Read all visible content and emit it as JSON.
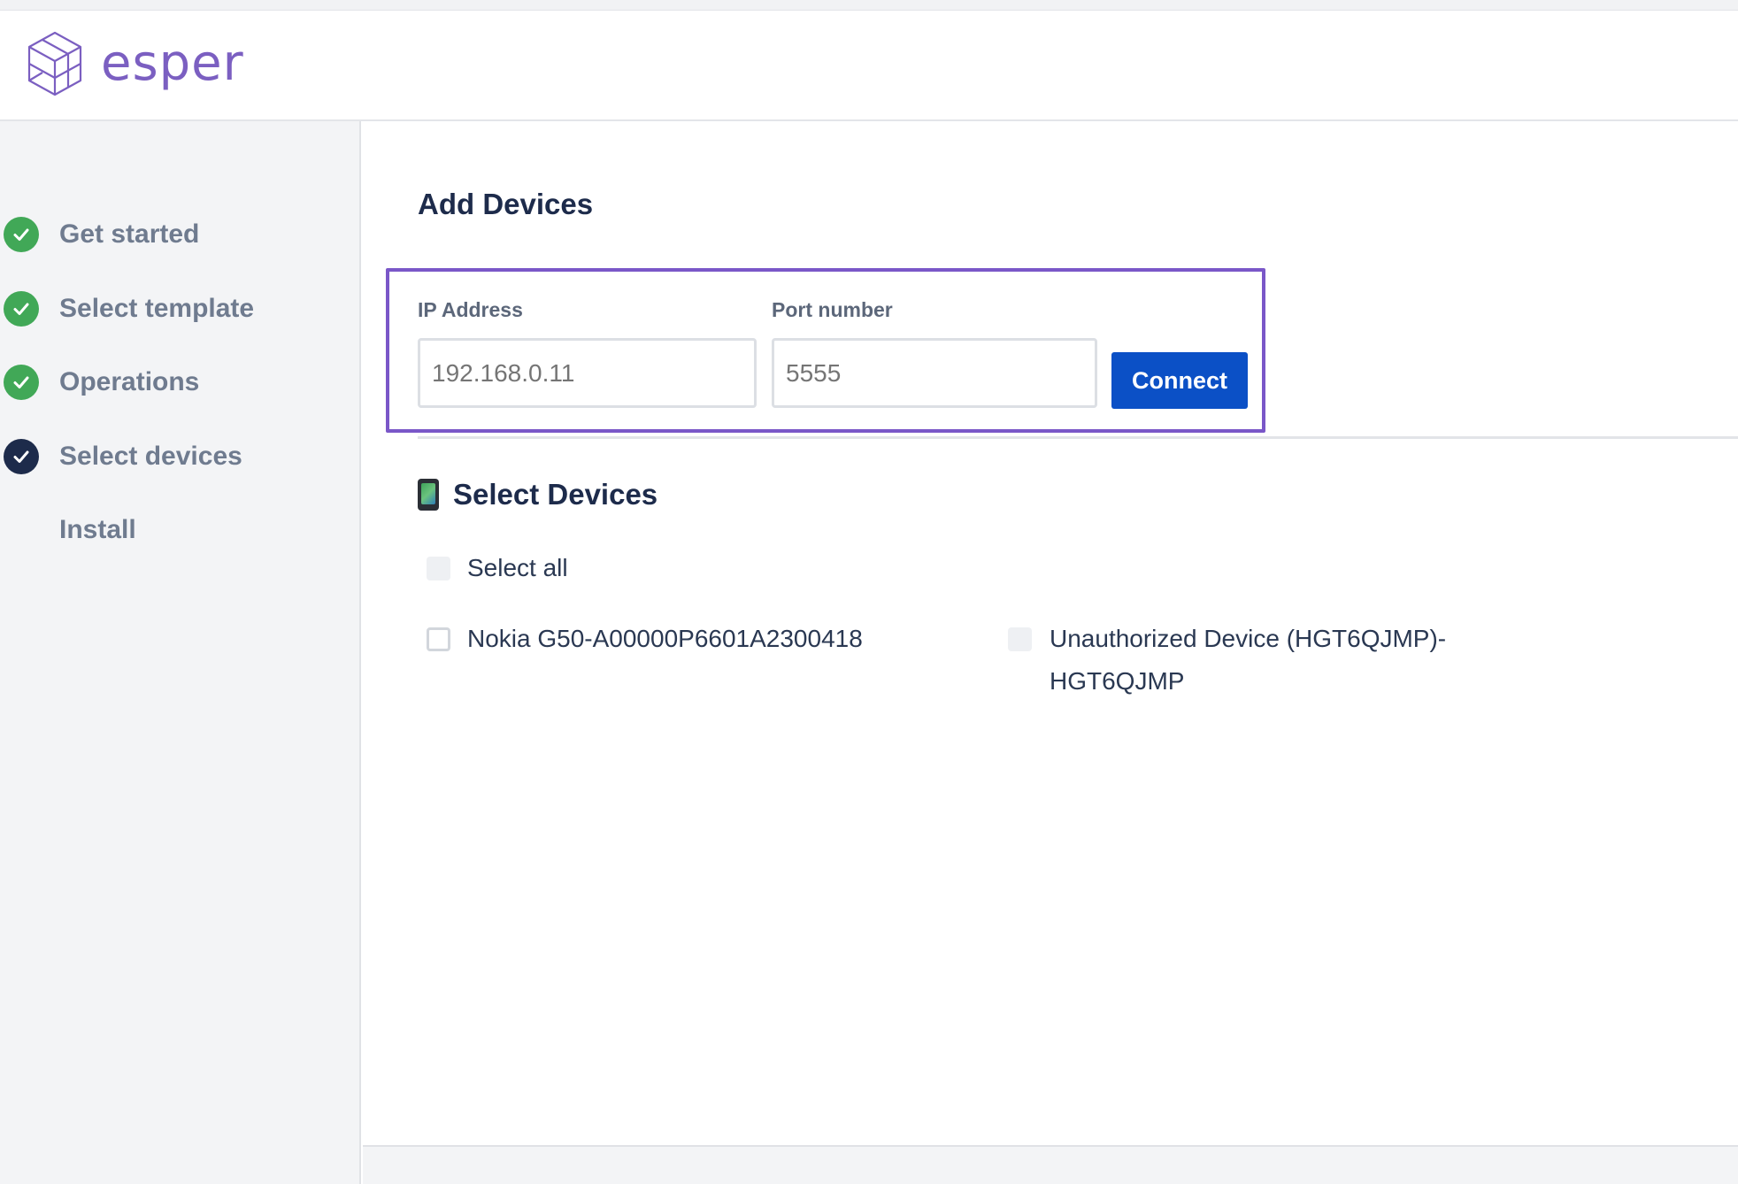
{
  "app": {
    "brand": "esper"
  },
  "steps": [
    {
      "label": "Get started",
      "status": "done"
    },
    {
      "label": "Select template",
      "status": "done"
    },
    {
      "label": "Operations",
      "status": "done"
    },
    {
      "label": "Select devices",
      "status": "current"
    },
    {
      "label": "Install",
      "status": "pending"
    }
  ],
  "add_devices": {
    "title": "Add Devices",
    "ip_label": "IP Address",
    "ip_placeholder": "192.168.0.11",
    "port_label": "Port number",
    "port_placeholder": "5555",
    "connect_label": "Connect"
  },
  "select_devices": {
    "title": "Select Devices",
    "select_all_label": "Select all",
    "devices": [
      {
        "name": "Nokia G50-A00000P6601A2300418",
        "checked": false,
        "enabled": true
      },
      {
        "name": "Unauthorized Device (HGT6QJMP)-HGT6QJMP",
        "name_line1": "Unauthorized Device (HGT6QJMP)-",
        "name_line2": "HGT6QJMP",
        "checked": false,
        "enabled": false
      }
    ]
  },
  "colors": {
    "brand": "#7b5fc1",
    "step_done": "#41a857",
    "step_current": "#1d2b4b",
    "primary_button": "#0b50c6",
    "highlight_border": "#7a57c8"
  }
}
